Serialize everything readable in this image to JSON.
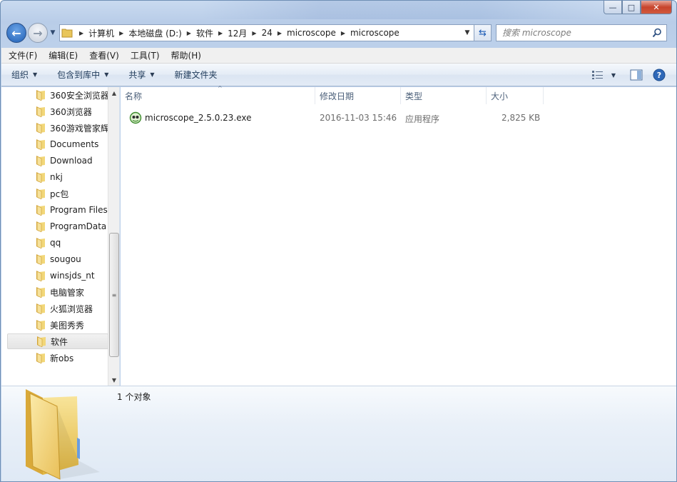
{
  "window": {
    "caption_min": "—",
    "caption_max": "□",
    "caption_close": "✕"
  },
  "navigation": {
    "breadcrumbs": [
      "计算机",
      "本地磁盘 (D:)",
      "软件",
      "12月",
      "24",
      "microscope",
      "microscope"
    ],
    "search_placeholder": "搜索 microscope"
  },
  "menu": {
    "items": [
      "文件(F)",
      "编辑(E)",
      "查看(V)",
      "工具(T)",
      "帮助(H)"
    ]
  },
  "toolbar": {
    "organize": "组织",
    "include_in_library": "包含到库中",
    "share": "共享",
    "new_folder": "新建文件夹"
  },
  "tree": {
    "items": [
      "360安全浏览器",
      "360浏览器",
      "360游戏管家辉",
      "Documents",
      "Download",
      "nkj",
      "pc包",
      "Program Files",
      "ProgramData",
      "qq",
      "sougou",
      "winsjds_nt",
      "电脑管家",
      "火狐浏览器",
      "美图秀秀",
      "软件",
      "新obs"
    ],
    "selected": "软件"
  },
  "columns": {
    "name": "名称",
    "modified": "修改日期",
    "type": "类型",
    "size": "大小"
  },
  "files": [
    {
      "name": "microscope_2.5.0.23.exe",
      "modified": "2016-11-03 15:46",
      "type": "应用程序",
      "size": "2,825 KB"
    }
  ],
  "details": {
    "status": "1 个对象"
  },
  "colors": {
    "folder": "#e9c65a",
    "accent": "#1f5fb5",
    "selection": "#e4e4e4"
  }
}
